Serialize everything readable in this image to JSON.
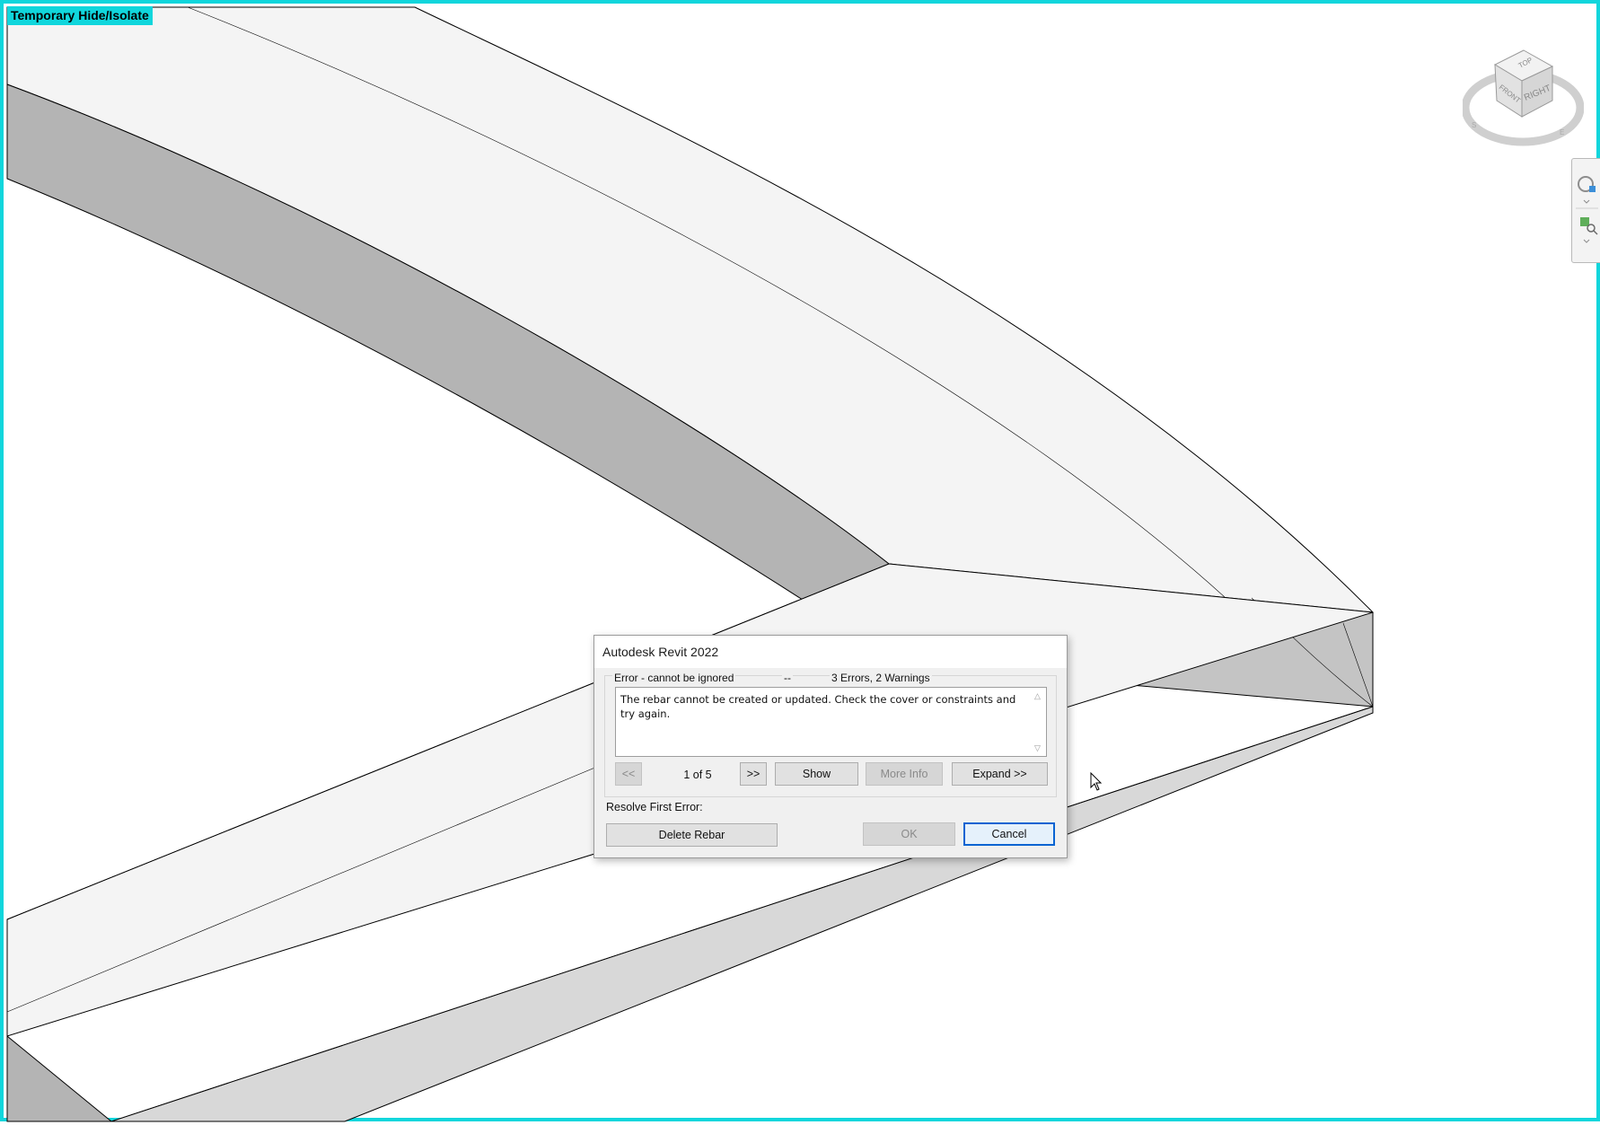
{
  "viewport": {
    "mode_label": "Temporary Hide/Isolate",
    "border_color": "#10d6dc"
  },
  "viewcube": {
    "faces": {
      "top": "TOP",
      "front": "FRONT",
      "right": "RIGHT"
    },
    "compass": {
      "south": "S",
      "east": "E"
    }
  },
  "navbar": {
    "items": [
      {
        "icon": "steering-wheel-icon"
      },
      {
        "icon": "zoom-icon"
      }
    ]
  },
  "dialog": {
    "title": "Autodesk Revit 2022",
    "severity": "Error - cannot be ignored",
    "separator": "--",
    "summary": "3 Errors, 2 Warnings",
    "message": "The rebar cannot be created or updated. Check the cover or constraints and try again.",
    "nav": {
      "prev_label": "<<",
      "next_label": ">>",
      "counter": "1 of 5"
    },
    "buttons": {
      "show": "Show",
      "more_info": "More Info",
      "expand": "Expand >>",
      "delete_rebar": "Delete Rebar",
      "ok": "OK",
      "cancel": "Cancel"
    },
    "resolve_label": "Resolve First Error:"
  },
  "colors": {
    "accent": "#0a64d2",
    "face_light": "#f4f4f4",
    "face_mid": "#d8d8d8",
    "face_dark": "#b4b4b4"
  }
}
